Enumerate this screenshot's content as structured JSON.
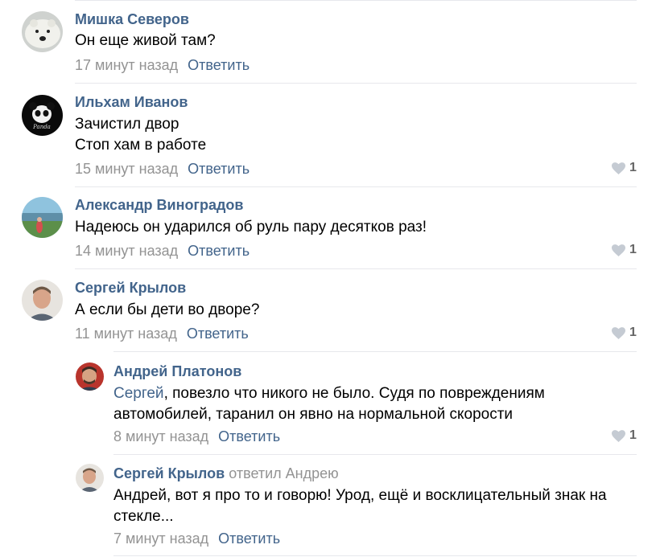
{
  "comments": [
    {
      "author": "Мишка Северов",
      "lines": [
        "Он еще живой там?"
      ],
      "time": "17 минут назад",
      "reply_label": "Ответить",
      "avatar_icon": "polar-bear-avatar"
    },
    {
      "author": "Ильхам Иванов",
      "lines": [
        "Зачистил двор",
        "Стоп хам в работе"
      ],
      "time": "15 минут назад",
      "reply_label": "Ответить",
      "likes": "1",
      "avatar_icon": "panda-avatar"
    },
    {
      "author": "Александр Виноградов",
      "lines": [
        "Надеюсь он ударился об руль пару десятков раз!"
      ],
      "time": "14 минут назад",
      "reply_label": "Ответить",
      "likes": "1",
      "avatar_icon": "landscape-avatar"
    },
    {
      "author": "Сергей Крылов",
      "lines": [
        "А если бы дети во дворе?"
      ],
      "time": "11 минут назад",
      "reply_label": "Ответить",
      "likes": "1",
      "avatar_icon": "man-avatar"
    },
    {
      "author": "Андрей Платонов",
      "mention": "Сергей",
      "lines": [
        ", повезло что никого не было. Судя по повреждениям",
        "автомобилей, таранил он явно на нормальной скорости"
      ],
      "time": "8 минут назад",
      "reply_label": "Ответить",
      "likes": "1",
      "avatar_icon": "man-red-background-avatar"
    },
    {
      "author": "Сергей Крылов",
      "replied_to": "ответил Андрею",
      "lines": [
        "Андрей, вот я про то и говорю! Урод, ещё и восклицательный знак на",
        "стекле..."
      ],
      "time": "7 минут назад",
      "reply_label": "Ответить",
      "avatar_icon": "man-avatar"
    }
  ],
  "colors": {
    "link": "#42648b",
    "meta": "#939393",
    "divider": "#e7e8ec",
    "like_heart": "#c5cbd3"
  }
}
